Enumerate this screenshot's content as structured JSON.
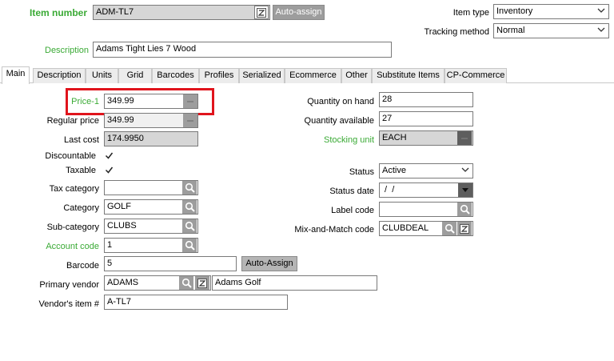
{
  "header": {
    "item_number_label": "Item number",
    "item_number_value": "ADM-TL7",
    "auto_assign_label": "Auto-assign",
    "description_label": "Description",
    "description_value": "Adams Tight Lies 7 Wood",
    "item_type_label": "Item type",
    "item_type_value": "Inventory",
    "tracking_method_label": "Tracking method",
    "tracking_method_value": "Normal"
  },
  "tabs": [
    {
      "label": "Main",
      "active": true
    },
    {
      "label": "Description"
    },
    {
      "label": "Units"
    },
    {
      "label": "Grid"
    },
    {
      "label": "Barcodes"
    },
    {
      "label": "Profiles"
    },
    {
      "label": "Serialized"
    },
    {
      "label": "Ecommerce"
    },
    {
      "label": "Other"
    },
    {
      "label": "Substitute Items"
    },
    {
      "label": "CP-Commerce"
    }
  ],
  "main": {
    "price1_label": "Price-1",
    "price1_value": "349.99",
    "regular_price_label": "Regular price",
    "regular_price_value": "349.99",
    "last_cost_label": "Last cost",
    "last_cost_value": "174.9950",
    "discountable_label": "Discountable",
    "discountable_checked": true,
    "taxable_label": "Taxable",
    "taxable_checked": true,
    "tax_category_label": "Tax category",
    "tax_category_value": "",
    "category_label": "Category",
    "category_value": "GOLF",
    "sub_category_label": "Sub-category",
    "sub_category_value": "CLUBS",
    "account_code_label": "Account code",
    "account_code_value": "1",
    "barcode_label": "Barcode",
    "barcode_value": "5",
    "barcode_auto_assign_label": "Auto-Assign",
    "primary_vendor_label": "Primary vendor",
    "primary_vendor_value": "ADAMS",
    "primary_vendor_name": "Adams Golf",
    "vendor_item_label": "Vendor's item #",
    "vendor_item_value": "A-TL7",
    "qty_on_hand_label": "Quantity on hand",
    "qty_on_hand_value": "28",
    "qty_available_label": "Quantity available",
    "qty_available_value": "27",
    "stocking_unit_label": "Stocking unit",
    "stocking_unit_value": "EACH",
    "status_label": "Status",
    "status_value": "Active",
    "status_date_label": "Status date",
    "status_date_value": " /  /",
    "label_code_label": "Label code",
    "label_code_value": "",
    "mix_match_label": "Mix-and-Match code",
    "mix_match_value": "CLUBDEAL"
  },
  "colors": {
    "accent_green": "#3aaa35",
    "highlight_red": "#e0141c",
    "button_grey": "#9d9d9d"
  }
}
